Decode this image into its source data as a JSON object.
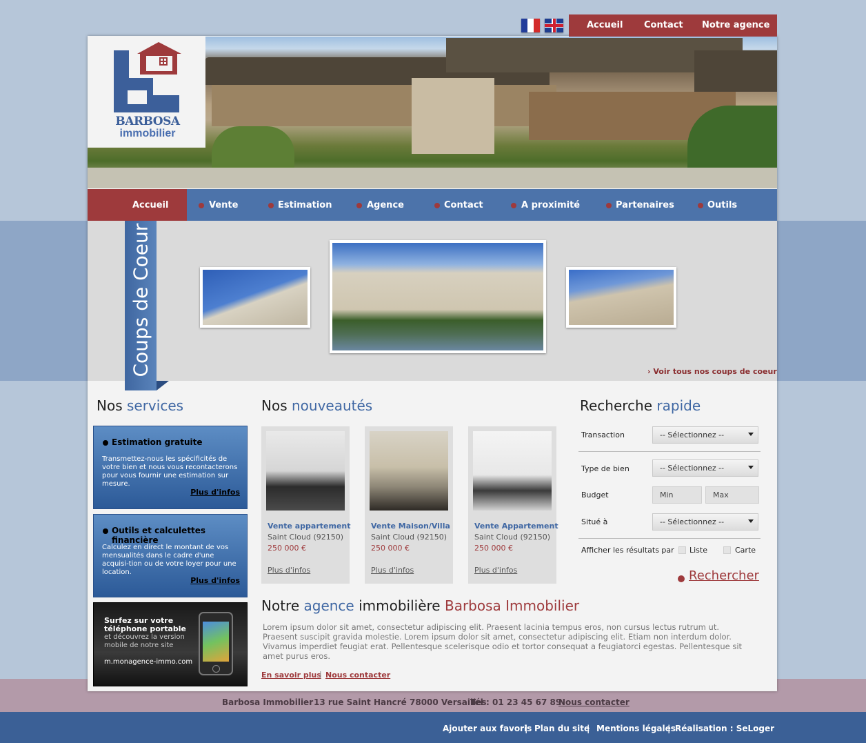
{
  "topbar": {
    "nav": [
      "Accueil",
      "Contact",
      "Notre agence"
    ]
  },
  "logo": {
    "line1": "BARBOSA",
    "line2": "immobilier"
  },
  "mainnav": {
    "items": [
      "Accueil",
      "Vente",
      "Estimation",
      "Agence",
      "Contact",
      "A proximité",
      "Partenaires",
      "Outils"
    ]
  },
  "featured": {
    "ribbon": "Coups de Coeur",
    "see_all": "› Voir tous nos coups de coeur"
  },
  "services": {
    "title_a": "Nos",
    "title_b": "services",
    "cards": [
      {
        "title": "Estimation gratuite",
        "desc": "Transmettez-nous les spécificités de votre bien et nous vous recontacterons pour vous fournir une estimation sur mesure.",
        "more": "Plus d'infos"
      },
      {
        "title": "Outils et calculettes financière",
        "desc": "Calculez en direct le montant de vos mensualités dans le cadre d'une acquisi-tion ou de votre loyer pour une location.",
        "more": "Plus d'infos"
      }
    ],
    "mobile": {
      "line1": "Surfez sur votre",
      "line2": "téléphone portable",
      "line3": "et découvrez la version",
      "line4": "mobile de notre site",
      "url": "m.monagence-immo.com"
    }
  },
  "news": {
    "title_a": "Nos",
    "title_b": "nouveautés",
    "items": [
      {
        "title": "Vente appartement",
        "location": "Saint Cloud  (92150)",
        "price": "250 000 €",
        "more": "Plus d'infos"
      },
      {
        "title": "Vente Maison/Villa",
        "location": "Saint Cloud  (92150)",
        "price": "250 000 €",
        "more": "Plus d'infos"
      },
      {
        "title": "Vente Appartement",
        "location": "Saint Cloud  (92150)",
        "price": "250 000 €",
        "more": "Plus d'infos"
      }
    ]
  },
  "search": {
    "title_a": "Recherche",
    "title_b": "rapide",
    "transaction_label": "Transaction",
    "transaction_value": "-- Sélectionnez --",
    "type_label": "Type de bien",
    "type_value": "-- Sélectionnez --",
    "budget_label": "Budget",
    "budget_min": "Min",
    "budget_max": "Max",
    "location_label": "Situé à",
    "location_value": "-- Sélectionnez --",
    "display_label": "Afficher les résultats par",
    "opt_list": "Liste",
    "opt_map": "Carte",
    "button": "Rechercher"
  },
  "agency": {
    "title_a": "Notre",
    "title_b": "agence",
    "title_c": "immobilière",
    "title_d": "Barbosa Immobilier",
    "text": "Lorem ipsum dolor sit amet, consectetur adipiscing elit. Praesent lacinia tempus eros, non cursus lectus rutrum ut. Praesent suscipit gravida molestie. Lorem ipsum dolor sit amet, consectetur adipiscing elit. Etiam non interdum dolor. Vivamus imperdiet feugiat erat. Pellentesque scelerisque odio et tortor consequat a feugiatorci egestas. Pellentesque sit amet purus eros.",
    "link1": "En savoir plus",
    "link2": "Nous contacter"
  },
  "footer": {
    "name": "Barbosa Immobilier",
    "address": "13 rue Saint Hancré 78000 Versailles",
    "phone": "Tél : 01 23 45 67 89",
    "contact": "Nous contacter",
    "links": [
      "Ajouter aux favoris",
      "Plan du site",
      "Mentions légales",
      "Réalisation : SeLoger"
    ]
  },
  "colors": {
    "accent_red": "#9e3a3c",
    "accent_blue": "#3f67a3"
  }
}
